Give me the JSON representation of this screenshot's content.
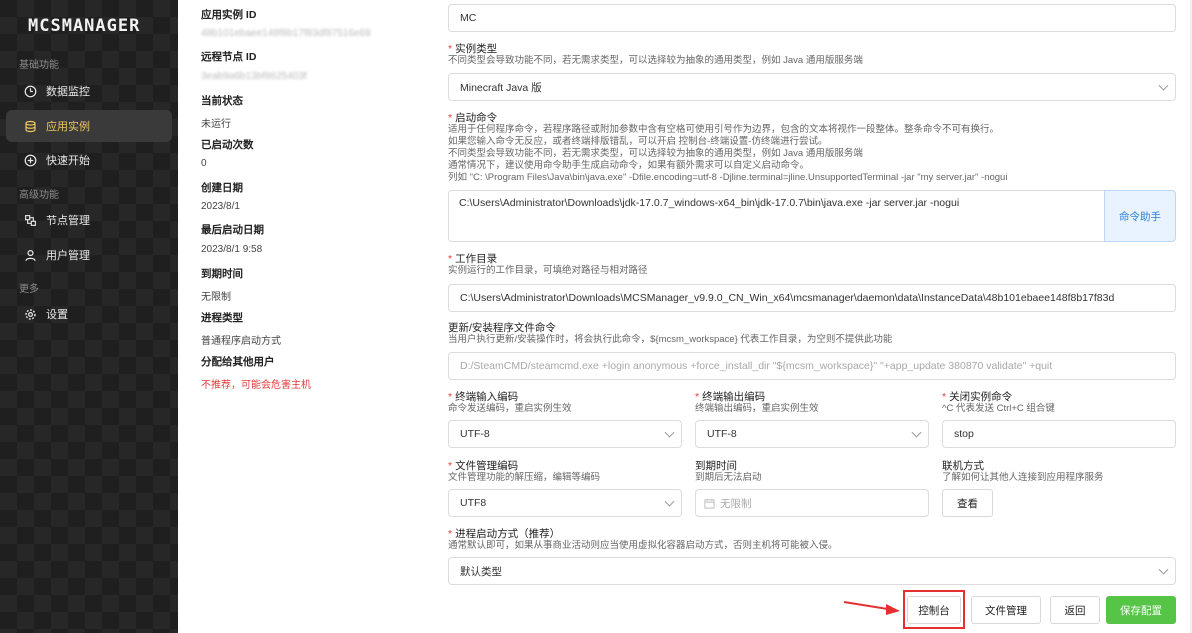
{
  "sidebar": {
    "logo": "MCSMANAGER",
    "groups": [
      {
        "label": "基础功能"
      },
      {
        "label": "高级功能"
      },
      {
        "label": "更多"
      }
    ],
    "items": [
      {
        "label": "数据监控",
        "icon": "dashboard-icon"
      },
      {
        "label": "应用实例",
        "icon": "database-icon",
        "active": true
      },
      {
        "label": "快速开始",
        "icon": "plus-circle-icon"
      },
      {
        "label": "节点管理",
        "icon": "nodes-icon"
      },
      {
        "label": "用户管理",
        "icon": "user-icon"
      },
      {
        "label": "设置",
        "icon": "gear-icon"
      }
    ],
    "active_color": "#f0c75e"
  },
  "info": {
    "instance_id_label": "应用实例 ID",
    "instance_id_value": "48b101ebaee148f8b17f83df87516e69",
    "node_id_label": "远程节点 ID",
    "node_id_value": "3eab9a6b13bf8625403f",
    "status_label": "当前状态",
    "status_value": "未运行",
    "start_count_label": "已启动次数",
    "start_count_value": "0",
    "create_date_label": "创建日期",
    "create_date_value": "2023/8/1",
    "last_start_label": "最后启动日期",
    "last_start_value": "2023/8/1 9:58",
    "expire_label": "到期时间",
    "expire_value": "无限制",
    "process_type_label": "进程类型",
    "process_type_value": "普通程序启动方式",
    "assign_label": "分配给其他用户",
    "assign_value": "不推荐，可能会危害主机",
    "warn_color": "#e23b3b"
  },
  "form": {
    "name_value": "MC",
    "instance_type": {
      "title": "实例类型",
      "desc": "不同类型会导致功能不同，若无需求类型，可以选择较为抽象的通用类型，例如 Java 通用版服务端",
      "value": "Minecraft Java 版"
    },
    "start_cmd": {
      "title": "启动命令",
      "desc1": "适用于任何程序命令，若程序路径或附加参数中含有空格可使用引号作为边界，包含的文本将视作一段整体。整条命令不可有换行。",
      "desc2": "如果您输入命令无反应，或者终端排版错乱，可以开启 控制台-终端设置-仿终端进行尝试。",
      "desc3": "不同类型会导致功能不同，若无需求类型，可以选择较为抽象的通用类型，例如 Java 通用版服务端",
      "desc4": "通常情况下，建议使用命令助手生成启动命令，如果有额外需求可以自定义启动命令。",
      "desc5": "列如 \"C: \\Program Files\\Java\\bin\\java.exe\" -Dfile.encoding=utf-8 -Djline.terminal=jline.UnsupportedTerminal -jar \"my server.jar\" -nogui",
      "value": "C:\\Users\\Administrator\\Downloads\\jdk-17.0.7_windows-x64_bin\\jdk-17.0.7\\bin\\java.exe -jar server.jar -nogui",
      "helper_label": "命令助手"
    },
    "work_dir": {
      "title": "工作目录",
      "desc": "实例运行的工作目录，可填绝对路径与相对路径",
      "value": "C:\\Users\\Administrator\\Downloads\\MCSManager_v9.9.0_CN_Win_x64\\mcsmanager\\daemon\\data\\InstanceData\\48b101ebaee148f8b17f83d"
    },
    "update_cmd": {
      "title": "更新/安装程序文件命令",
      "desc": "当用户执行更新/安装操作时，将会执行此命令，${mcsm_workspace} 代表工作目录，为空则不提供此功能",
      "placeholder": "D:/SteamCMD/steamcmd.exe +login anonymous +force_install_dir \"${mcsm_workspace}\" \"+app_update 380870 validate\" +quit"
    },
    "input_encoding": {
      "title": "终端输入编码",
      "desc": "命令发送编码，重启实例生效",
      "value": "UTF-8"
    },
    "output_encoding": {
      "title": "终端输出编码",
      "desc": "终端输出编码，重启实例生效",
      "value": "UTF-8"
    },
    "stop_cmd": {
      "title": "关闭实例命令",
      "desc": "^C 代表发送 Ctrl+C 组合键",
      "value": "stop"
    },
    "file_encoding": {
      "title": "文件管理编码",
      "desc": "文件管理功能的解压缩，编辑等编码",
      "value": "UTF8"
    },
    "expire": {
      "title": "到期时间",
      "desc": "到期后无法启动",
      "placeholder": "无限制"
    },
    "network": {
      "title": "联机方式",
      "desc": "了解如何让其他人连接到应用程序服务",
      "button": "查看"
    },
    "process_mode": {
      "title": "进程启动方式（推荐）",
      "desc": "通常默认即可，如果从事商业活动则应当使用虚拟化容器启动方式，否则主机将可能被入侵。",
      "value": "默认类型"
    }
  },
  "actions": {
    "console": "控制台",
    "file_manager": "文件管理",
    "back": "返回",
    "save": "保存配置",
    "save_color": "#56c447",
    "highlight_color": "#e43030"
  }
}
